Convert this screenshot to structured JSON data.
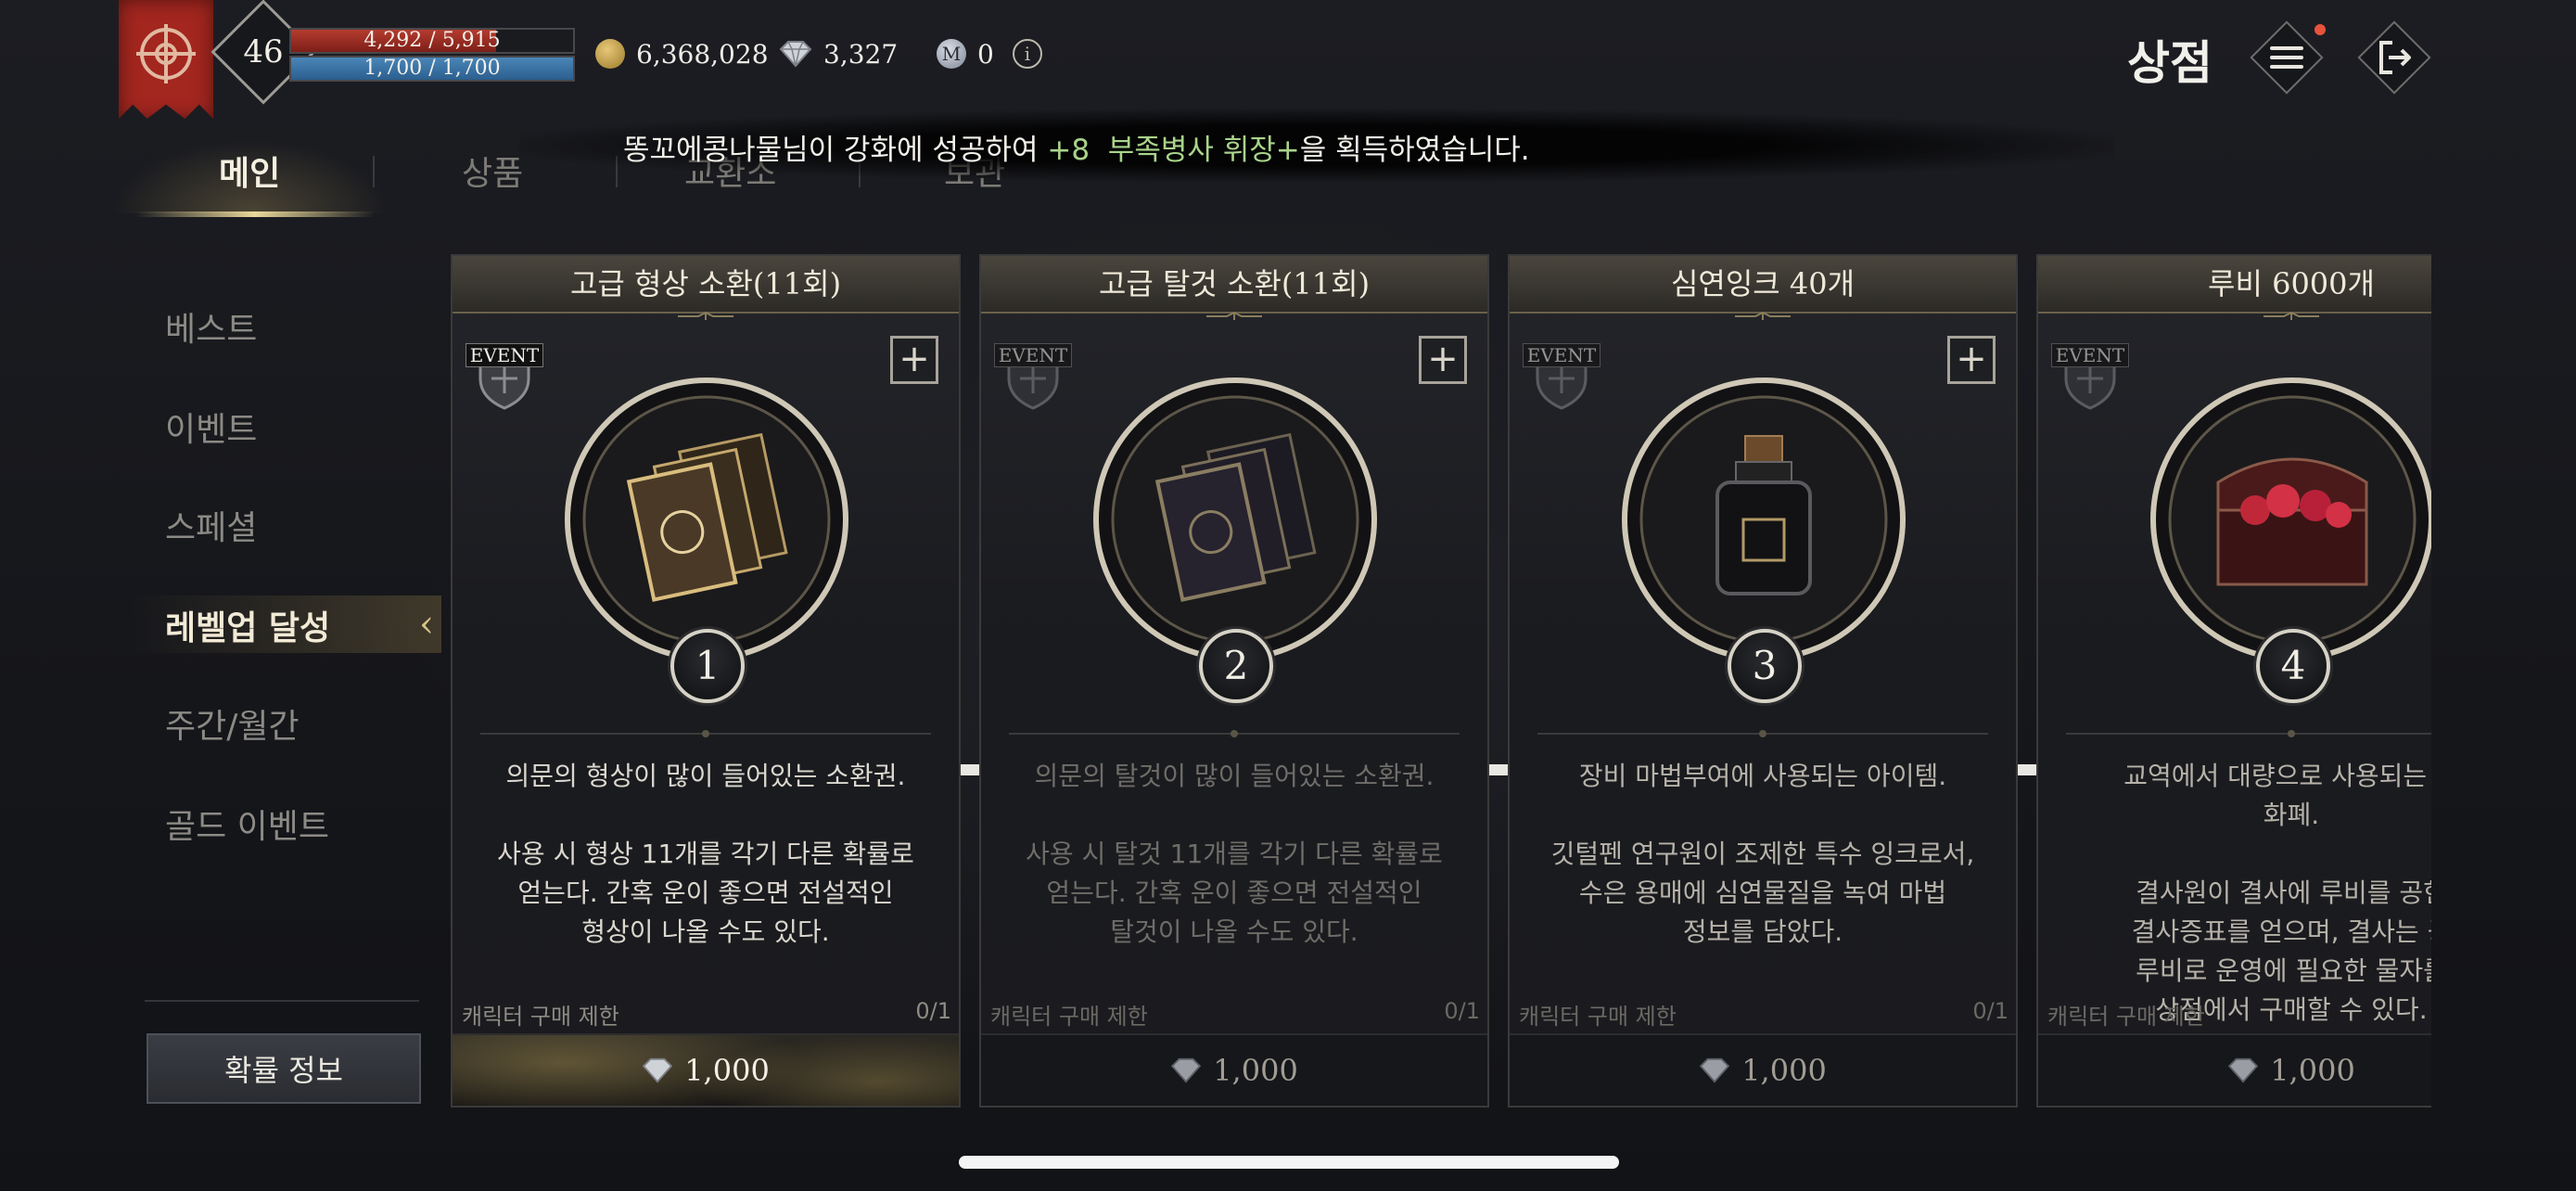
{
  "player": {
    "level": "46",
    "hp": "4,292 / 5,915",
    "hp_fraction": 0.726,
    "mp": "1,700 / 1,700",
    "mp_fraction": 1.0
  },
  "currencies": {
    "gold": "6,368,028",
    "gems": "3,327",
    "silver": "0",
    "silver_icon_letter": "M",
    "info_symbol": "i"
  },
  "header": {
    "title": "상점"
  },
  "ticker": {
    "user": "똥꼬에콩나물",
    "text_before": "님이 강화에 성공하여 ",
    "enhance": "+8",
    "item": "부족병사 휘장+",
    "text_after": "을 획득하였습니다."
  },
  "tabs": [
    {
      "label": "메인",
      "active": true
    },
    {
      "label": "상품",
      "active": false
    },
    {
      "label": "교환소",
      "active": false
    },
    {
      "label": "보관",
      "active": false
    }
  ],
  "sidebar": {
    "items": [
      {
        "label": "베스트"
      },
      {
        "label": "이벤트"
      },
      {
        "label": "스페셜"
      },
      {
        "label": "레벨업 달성",
        "active": true
      },
      {
        "label": "주간/월간"
      },
      {
        "label": "골드 이벤트"
      }
    ],
    "active_marker": "‹",
    "probability_button": "확률 정보"
  },
  "cards": [
    {
      "title": "고급 형상 소환(11회)",
      "badge": "EVENT",
      "step": "1",
      "desc": "의문의 형상이 많이 들어있는 소환권.\n\n사용 시 형상 11개를 각기 다른 확률로\n얻는다. 간혹 운이 좋으면 전설적인\n형상이 나올 수도 있다.",
      "limit_label": "캐릭터 구매 제한",
      "limit_value": "0/1",
      "price": "1,000",
      "plus": "+"
    },
    {
      "title": "고급 탈것 소환(11회)",
      "badge": "EVENT",
      "step": "2",
      "desc": "의문의 탈것이 많이 들어있는 소환권.\n\n사용 시 탈것 11개를 각기 다른 확률로\n얻는다. 간혹 운이 좋으면 전설적인\n탈것이 나올 수도 있다.",
      "limit_label": "캐릭터 구매 제한",
      "limit_value": "0/1",
      "price": "1,000",
      "plus": "+"
    },
    {
      "title": "심연잉크 40개",
      "badge": "EVENT",
      "step": "3",
      "desc": "장비 마법부여에 사용되는 아이템.\n\n깃털펜 연구원이 조제한 특수 잉크로서,\n수은 용매에 심연물질을 녹여 마법\n정보를 담았다.",
      "limit_label": "캐릭터 구매 제한",
      "limit_value": "0/1",
      "price": "1,000",
      "plus": "+"
    },
    {
      "title": "루비 6000개",
      "badge": "EVENT",
      "step": "4",
      "desc": "교역에서 대량으로 사용되는 복\n화폐.\n\n결사원이 결사에 루비를 공헌\n결사증표를 얻으며, 결사는 공\n루비로 운영에 필요한 물자를\n상점에서 구매할 수 있다.",
      "limit_label": "캐릭터 구매 제한",
      "limit_value": "",
      "price": "1,000",
      "plus": ""
    }
  ],
  "colors": {
    "accent_gold": "#e9d89b",
    "hp_red": "#b43c30",
    "mp_blue": "#4a86b8",
    "ticker_green": "#a9d48b",
    "banner_red": "#a3261f"
  },
  "icons": {
    "banner": "guild-emblem-icon",
    "gold": "gold-coin-icon",
    "gem": "gem-icon",
    "silver": "silver-coin-icon",
    "menu": "hamburger-menu-icon",
    "exit": "exit-icon"
  }
}
